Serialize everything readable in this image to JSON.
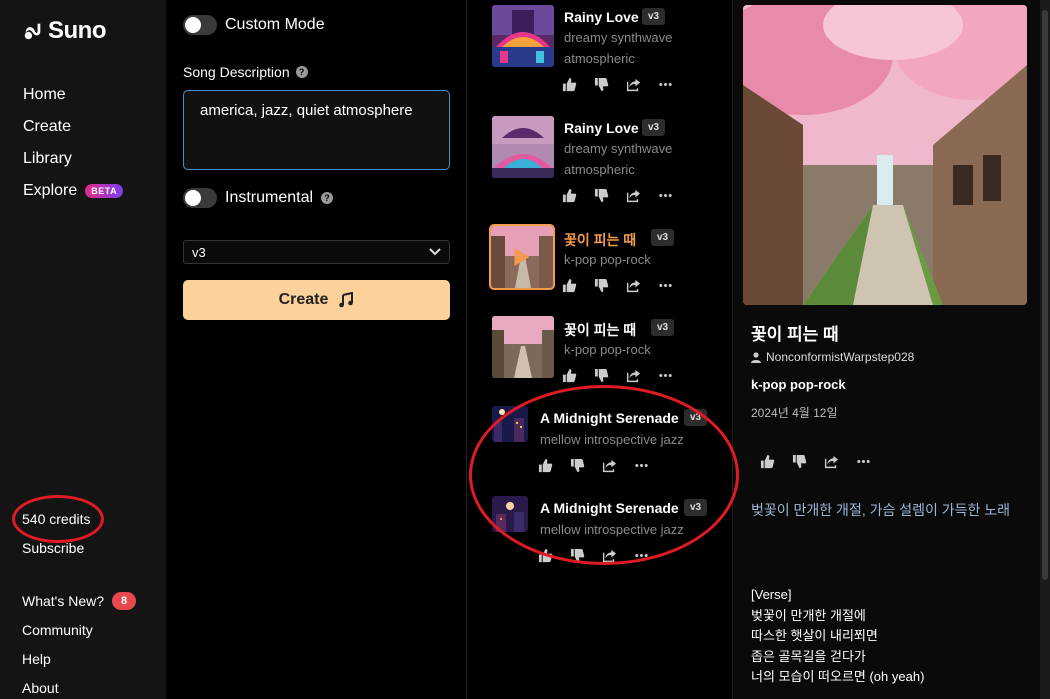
{
  "sidebar": {
    "logo": "Suno",
    "nav": [
      {
        "label": "Home"
      },
      {
        "label": "Create"
      },
      {
        "label": "Library"
      },
      {
        "label": "Explore",
        "badge": "BETA"
      }
    ],
    "credits": "540 credits",
    "subscribe": "Subscribe",
    "whats_new": "What's New?",
    "whats_new_count": "8",
    "community": "Community",
    "help": "Help",
    "about": "About"
  },
  "create": {
    "custom_mode_label": "Custom Mode",
    "description_label": "Song Description",
    "description_value": "america, jazz, quiet atmosphere",
    "instrumental_label": "Instrumental",
    "model_value": "v3",
    "create_label": "Create"
  },
  "songs": [
    {
      "title": "Rainy Love",
      "version": "v3",
      "tags": "dreamy synthwave atmospheric"
    },
    {
      "title": "Rainy Love",
      "version": "v3",
      "tags": "dreamy synthwave atmospheric"
    },
    {
      "title": "꽃이 피는 때",
      "version": "v3",
      "tags": "k-pop pop-rock"
    },
    {
      "title": "꽃이 피는 때",
      "version": "v3",
      "tags": "k-pop pop-rock"
    },
    {
      "title": "A Midnight Serenade",
      "version": "v3",
      "tags": "mellow introspective jazz"
    },
    {
      "title": "A Midnight Serenade",
      "version": "v3",
      "tags": "mellow introspective jazz"
    }
  ],
  "detail": {
    "title": "꽃이 피는 때",
    "user": "NonconformistWarpstep028",
    "tags": "k-pop pop-rock",
    "date": "2024년 4월 12일",
    "description": "벚꽃이 만개한 개절, 가슴 설렘이 가득한 노래",
    "lyrics": [
      "[Verse]",
      "벚꽃이 만개한 개절에",
      "따스한 햇살이 내리쬐면",
      "좁은 골목길을 걷다가",
      "너의 모습이 떠오르면 (oh yeah)"
    ]
  },
  "colors": {
    "accent": "#fdd19a",
    "active": "#f49a4c",
    "annotation": "#e01b24"
  }
}
